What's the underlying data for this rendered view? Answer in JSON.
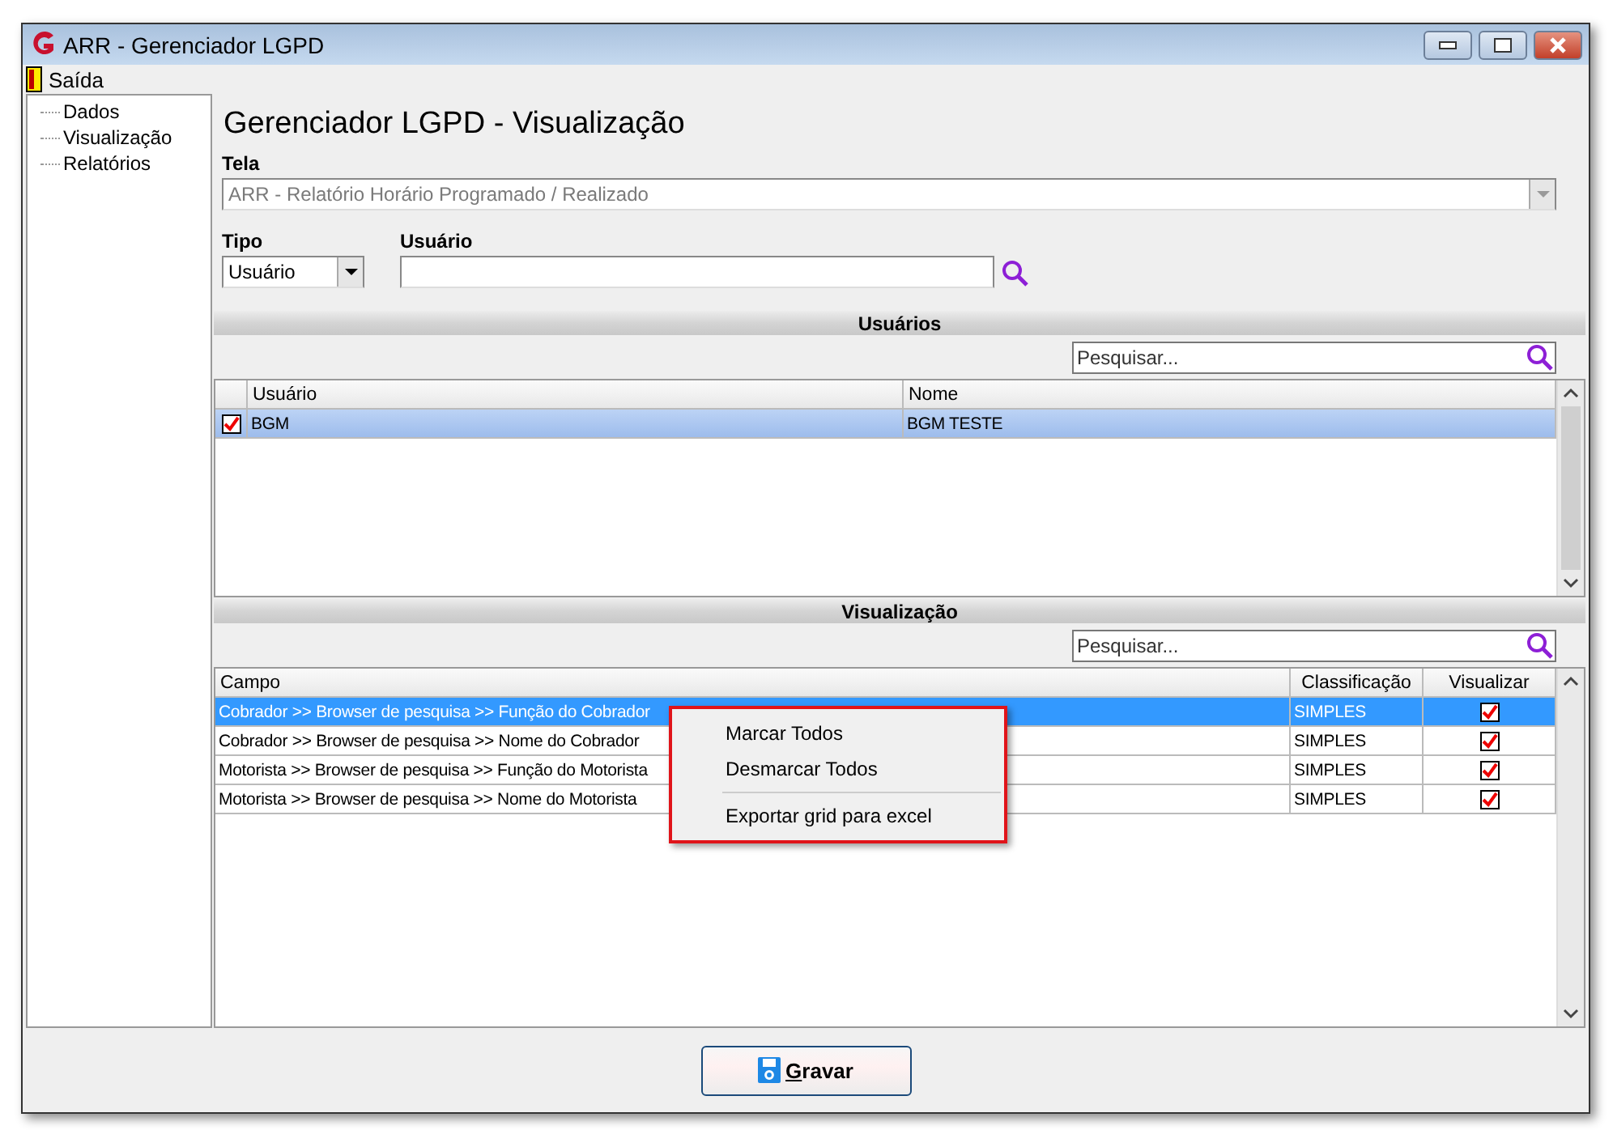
{
  "window": {
    "title": "ARR - Gerenciador LGPD"
  },
  "menu": [
    {
      "label": "Saída"
    }
  ],
  "sidebar": {
    "items": [
      {
        "label": "Dados"
      },
      {
        "label": "Visualização"
      },
      {
        "label": "Relatórios"
      }
    ]
  },
  "heading": "Gerenciador LGPD - Visualização",
  "tela": {
    "label": "Tela",
    "value": "ARR - Relatório Horário Programado / Realizado",
    "disabled": true
  },
  "tipo": {
    "label": "Tipo",
    "value": "Usuário"
  },
  "usuario": {
    "label": "Usuário"
  },
  "usuarios": {
    "title": "Usuários",
    "search_placeholder": "Pesquisar...",
    "columns": [
      "Usuário",
      "Nome"
    ],
    "rows": [
      {
        "checked": true,
        "usuario": "BGM",
        "nome": "BGM TESTE",
        "selected": true
      }
    ]
  },
  "visualizacao": {
    "title": "Visualização",
    "search_placeholder": "Pesquisar...",
    "columns": [
      "Campo",
      "Classificação",
      "Visualizar"
    ],
    "rows": [
      {
        "campo": "Cobrador >> Browser de pesquisa >> Função do Cobrador",
        "classificacao": "SIMPLES",
        "visualizar": true,
        "selected": true
      },
      {
        "campo": "Cobrador >> Browser de pesquisa >> Nome do Cobrador",
        "classificacao": "SIMPLES",
        "visualizar": true,
        "selected": false
      },
      {
        "campo": "Motorista >> Browser de pesquisa >> Função do Motorista",
        "classificacao": "SIMPLES",
        "visualizar": true,
        "selected": false
      },
      {
        "campo": "Motorista >> Browser de pesquisa >> Nome do Motorista",
        "classificacao": "SIMPLES",
        "visualizar": true,
        "selected": false
      }
    ]
  },
  "context_menu": {
    "items": [
      {
        "kind": "item",
        "label": "Marcar Todos"
      },
      {
        "kind": "item",
        "label": "Desmarcar Todos"
      },
      {
        "kind": "separator"
      },
      {
        "kind": "item",
        "label": "Exportar grid para excel"
      }
    ]
  },
  "save_button": "Gravar"
}
